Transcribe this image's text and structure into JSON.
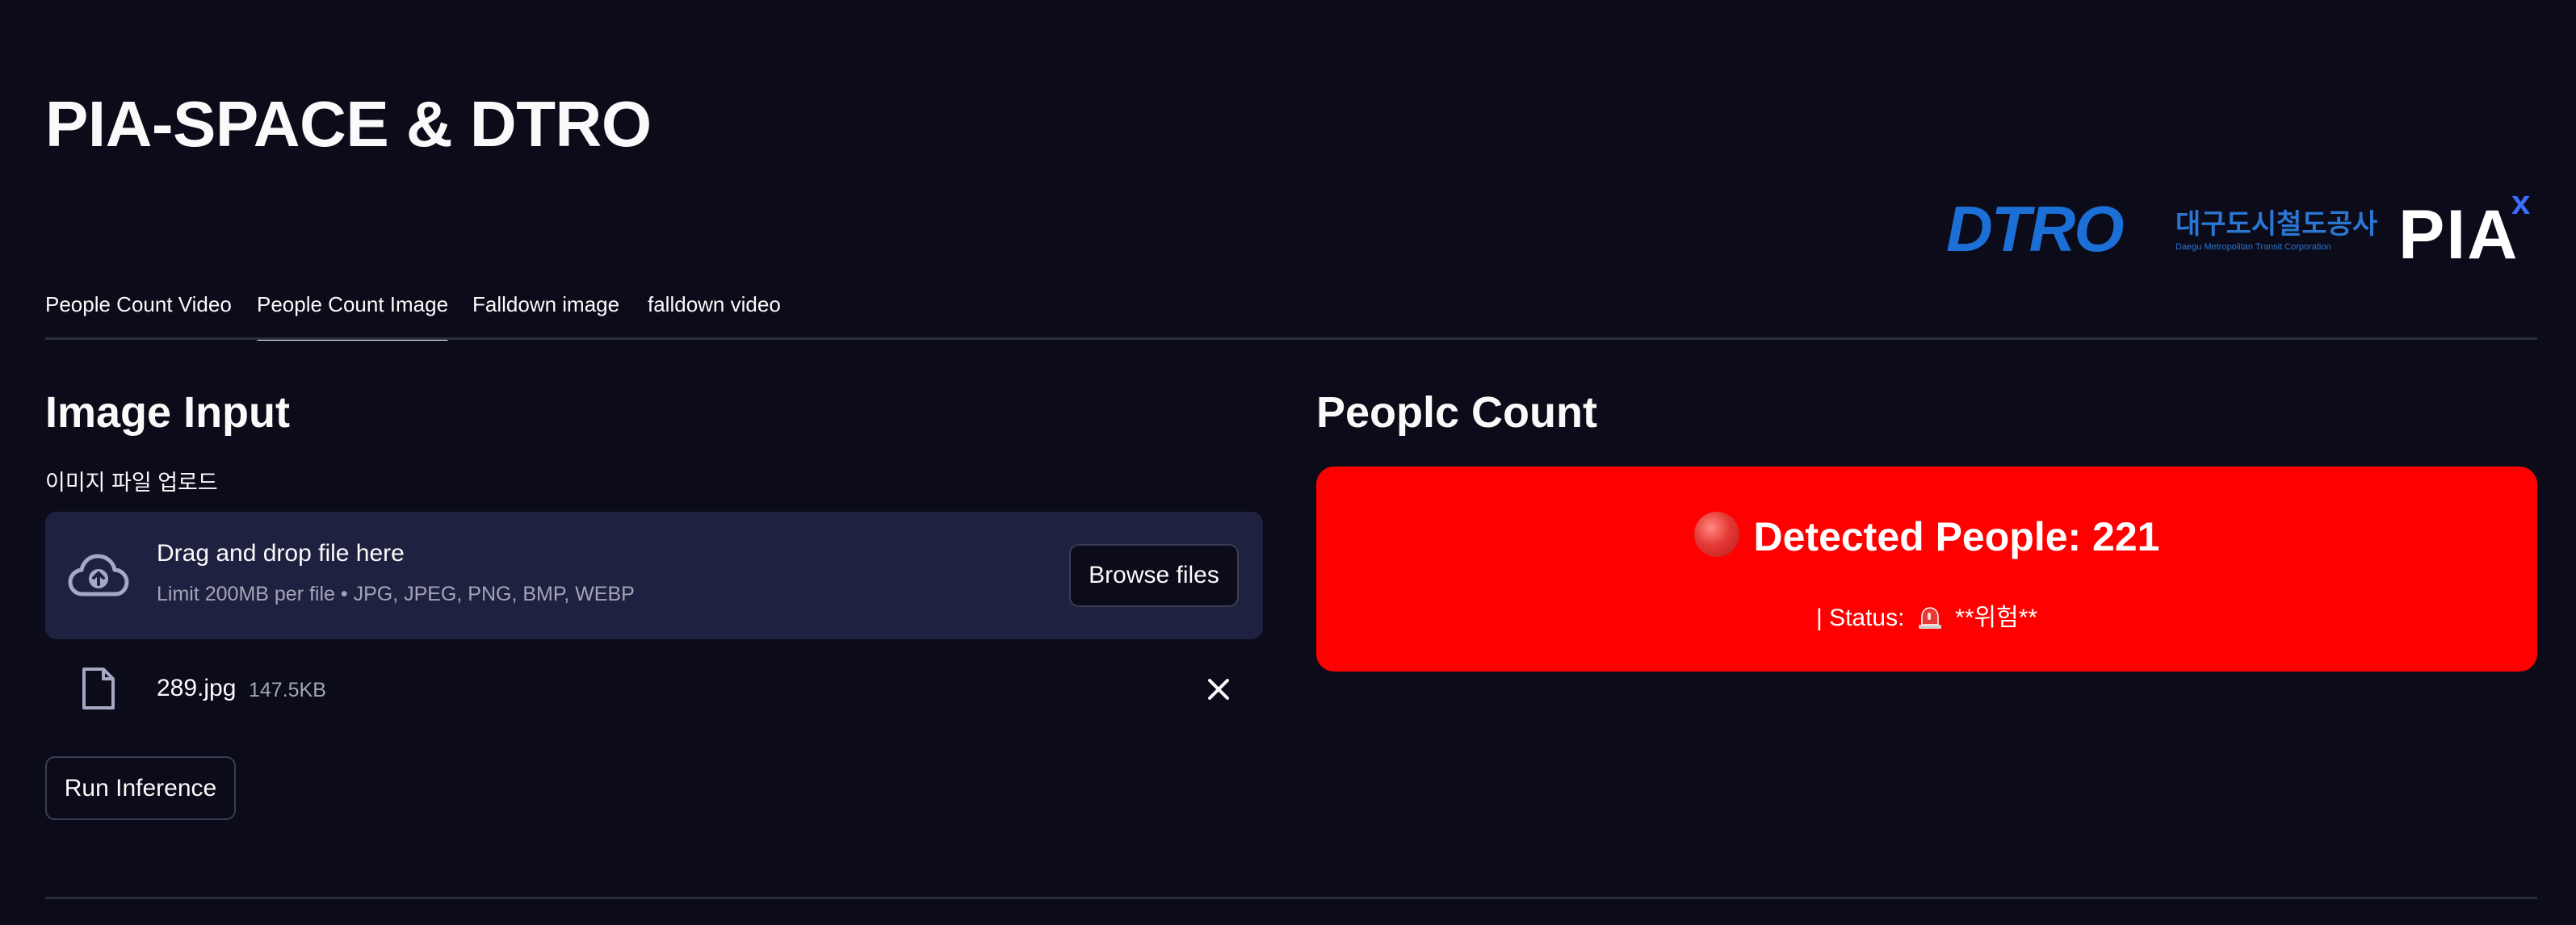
{
  "app": {
    "title": "PIA-SPACE & DTRO"
  },
  "logos": {
    "dtro_wordmark": "DTRO",
    "dtro_korean": "대구도시철도공사",
    "dtro_english": "Daegu Metropolitan Transit Corporation",
    "pia_wordmark": "PIA",
    "pia_mark": "x",
    "colors": {
      "dtro_blue": "#1c6fd6",
      "pia_accent": "#3b6cff"
    }
  },
  "tabs": [
    {
      "label": "People Count Video",
      "active": false
    },
    {
      "label": "People Count Image",
      "active": true
    },
    {
      "label": "Falldown image",
      "active": false
    },
    {
      "label": "falldown video",
      "active": false
    }
  ],
  "input": {
    "heading": "Image Input",
    "upload_label": "이미지 파일 업로드",
    "dropzone": {
      "title": "Drag and drop file here",
      "subtitle": "Limit 200MB per file • JPG, JPEG, PNG, BMP, WEBP",
      "browse_label": "Browse files",
      "icon": "cloud-upload-icon"
    },
    "file": {
      "name": "289.jpg",
      "size": "147.5KB",
      "icon": "file-icon",
      "remove_icon": "close-icon"
    },
    "run_label": "Run Inference"
  },
  "result": {
    "heading": "Peoplc Count",
    "detected_text": "Detected People: 221",
    "detected_icon": "red-circle-icon",
    "status_prefix": "| Status:",
    "status_icon": "siren-icon",
    "status_value": "**위험**",
    "card_color": "#ff0000"
  }
}
